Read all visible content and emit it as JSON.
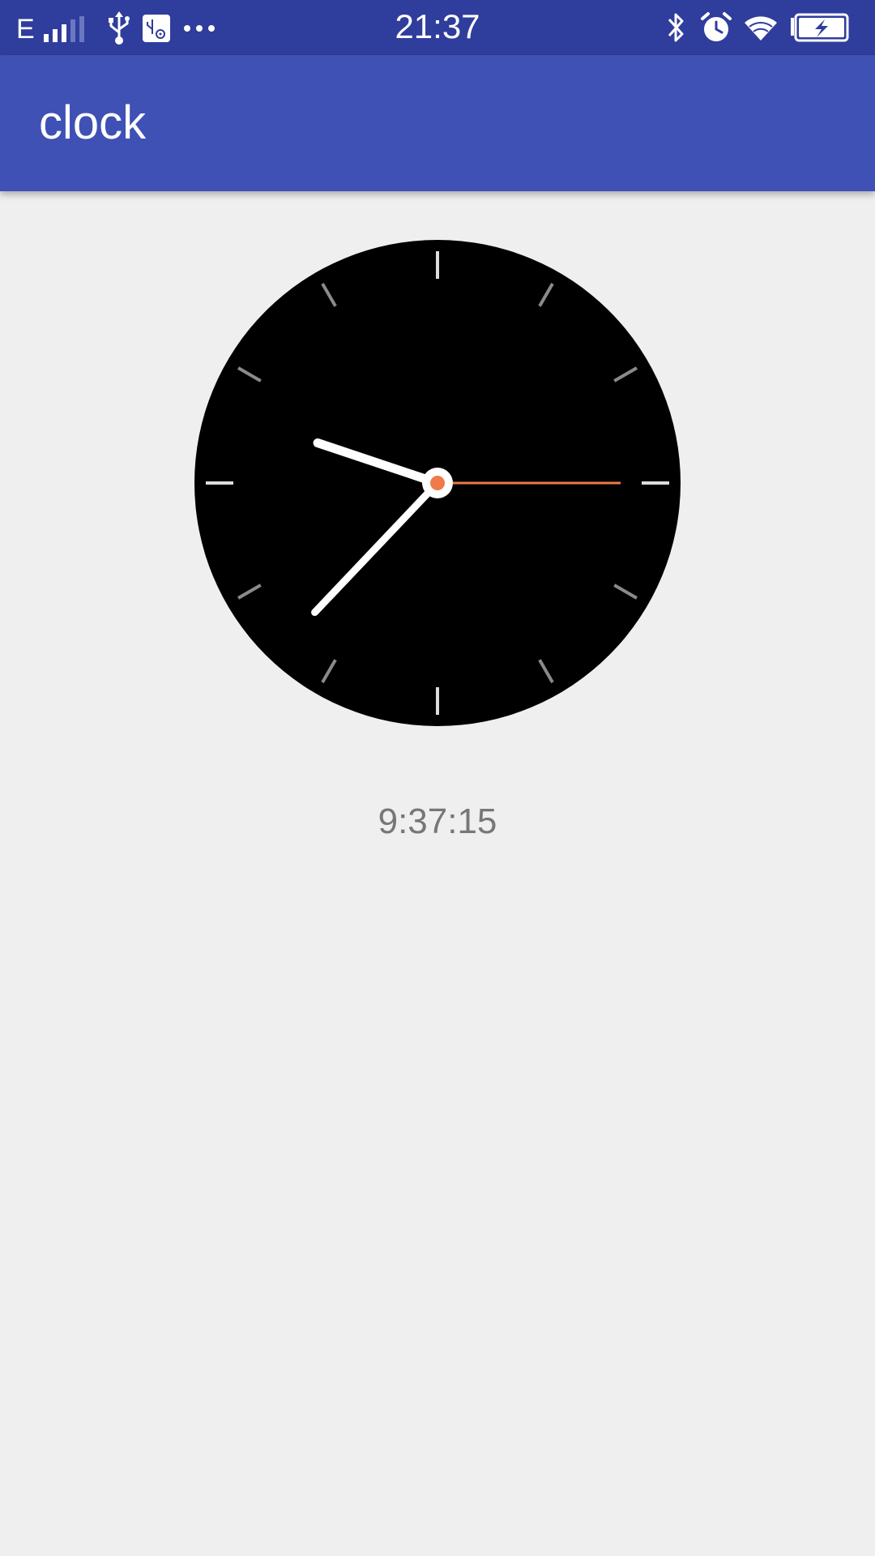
{
  "status_bar": {
    "network_type": "E",
    "time": "21:37",
    "icons": [
      "signal-icon",
      "usb-icon",
      "usb-settings-icon",
      "more-dots-icon",
      "bluetooth-icon",
      "alarm-icon",
      "wifi-icon",
      "battery-charging-icon"
    ]
  },
  "app_bar": {
    "title": "clock"
  },
  "clock": {
    "hour": 9,
    "minute": 37,
    "second": 15,
    "face_color": "#000000",
    "hand_color": "#ffffff",
    "second_hand_color": "#f07a4a",
    "digital_time": "9:37:15"
  },
  "colors": {
    "status_bar": "#2f3d9c",
    "app_bar": "#3f51b5",
    "background": "#efefef"
  }
}
